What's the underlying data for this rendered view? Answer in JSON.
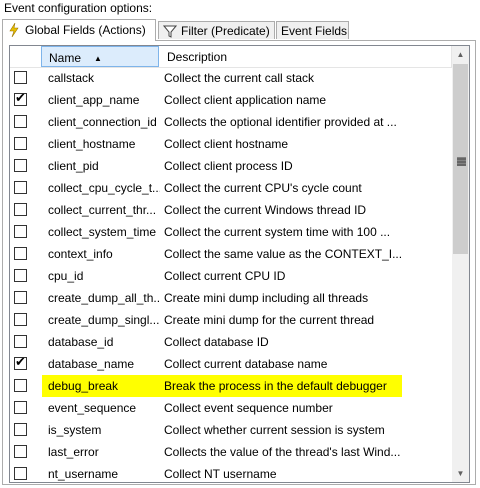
{
  "title": "Event configuration options:",
  "tabs": [
    {
      "label": "Global Fields (Actions)",
      "icon": "lightning-icon"
    },
    {
      "label": "Filter (Predicate)",
      "icon": "filter-icon"
    },
    {
      "label": "Event Fields"
    }
  ],
  "columns": {
    "name": "Name",
    "description": "Description"
  },
  "rows": [
    {
      "name": "callstack",
      "description": "Collect the current call stack",
      "checked": false
    },
    {
      "name": "client_app_name",
      "description": "Collect client application name",
      "checked": true
    },
    {
      "name": "client_connection_id",
      "description": "Collects the optional identifier provided at ...",
      "checked": false
    },
    {
      "name": "client_hostname",
      "description": "Collect client hostname",
      "checked": false
    },
    {
      "name": "client_pid",
      "description": "Collect client process ID",
      "checked": false
    },
    {
      "name": "collect_cpu_cycle_t...",
      "description": "Collect the current CPU's cycle count",
      "checked": false
    },
    {
      "name": "collect_current_thr...",
      "description": "Collect the current Windows thread ID",
      "checked": false
    },
    {
      "name": "collect_system_time",
      "description": "Collect the current system time with 100 ...",
      "checked": false
    },
    {
      "name": "context_info",
      "description": "Collect the same value as the CONTEXT_I...",
      "checked": false
    },
    {
      "name": "cpu_id",
      "description": "Collect current CPU ID",
      "checked": false
    },
    {
      "name": "create_dump_all_th...",
      "description": "Create mini dump including all threads",
      "checked": false
    },
    {
      "name": "create_dump_singl...",
      "description": "Create mini dump for the current thread",
      "checked": false
    },
    {
      "name": "database_id",
      "description": "Collect database ID",
      "checked": false
    },
    {
      "name": "database_name",
      "description": "Collect current database name",
      "checked": true
    },
    {
      "name": "debug_break",
      "description": "Break the process in the default debugger",
      "checked": false,
      "highlight": true
    },
    {
      "name": "event_sequence",
      "description": "Collect event sequence number",
      "checked": false
    },
    {
      "name": "is_system",
      "description": "Collect whether current session is system",
      "checked": false
    },
    {
      "name": "last_error",
      "description": "Collects the value of the thread's last Wind...",
      "checked": false
    },
    {
      "name": "nt_username",
      "description": "Collect NT username",
      "checked": false
    }
  ],
  "colors": {
    "highlight": "#ffff00",
    "header_selected": "#dcecfc"
  }
}
